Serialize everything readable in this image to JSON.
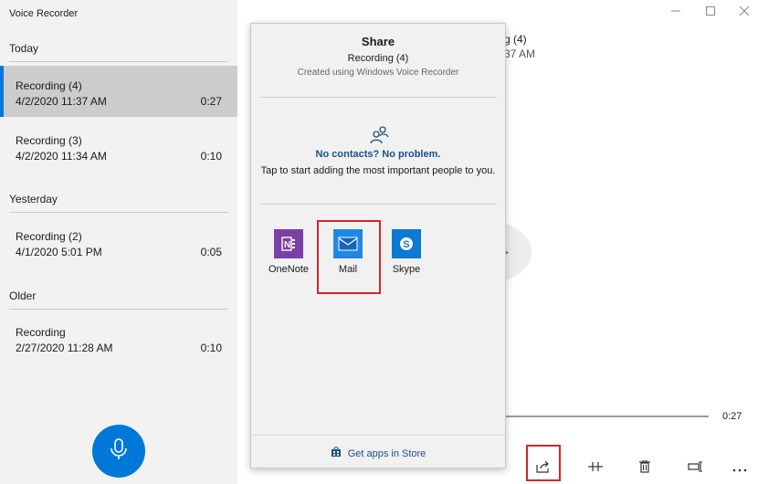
{
  "app": {
    "title": "Voice Recorder"
  },
  "sections": [
    {
      "header": "Today"
    },
    {
      "header": "Yesterday"
    },
    {
      "header": "Older"
    }
  ],
  "recordings": [
    {
      "name": "Recording (4)",
      "date": "4/2/2020 11:37 AM",
      "duration": "0:27",
      "selected": true
    },
    {
      "name": "Recording (3)",
      "date": "4/2/2020 11:34 AM",
      "duration": "0:10",
      "selected": false
    },
    {
      "name": "Recording (2)",
      "date": "4/1/2020 5:01 PM",
      "duration": "0:05",
      "selected": false
    },
    {
      "name": "Recording",
      "date": "2/27/2020 11:28 AM",
      "duration": "0:10",
      "selected": false
    }
  ],
  "player": {
    "title_fragment": "g (4)",
    "date_fragment": "37 AM",
    "total_time": "0:27"
  },
  "share": {
    "title": "Share",
    "item": "Recording (4)",
    "subtitle": "Created using Windows Voice Recorder",
    "contacts_title": "No contacts? No problem.",
    "contacts_sub": "Tap to start adding the most important people to you.",
    "apps": [
      {
        "label": "OneNote",
        "color": "#7b3fa6"
      },
      {
        "label": "Mail",
        "color": "#1e88e5"
      },
      {
        "label": "Skype",
        "color": "#0b7ad1"
      }
    ],
    "store_link": "Get apps in Store"
  },
  "colors": {
    "accent": "#0078d7",
    "highlight": "#d4252a"
  },
  "icons": [
    "microphone-icon",
    "contacts-icon",
    "onenote-icon",
    "mail-icon",
    "skype-icon",
    "store-icon",
    "share-icon",
    "trim-icon",
    "delete-icon",
    "rename-icon",
    "more-icon",
    "minimize-icon",
    "maximize-icon",
    "close-icon"
  ]
}
